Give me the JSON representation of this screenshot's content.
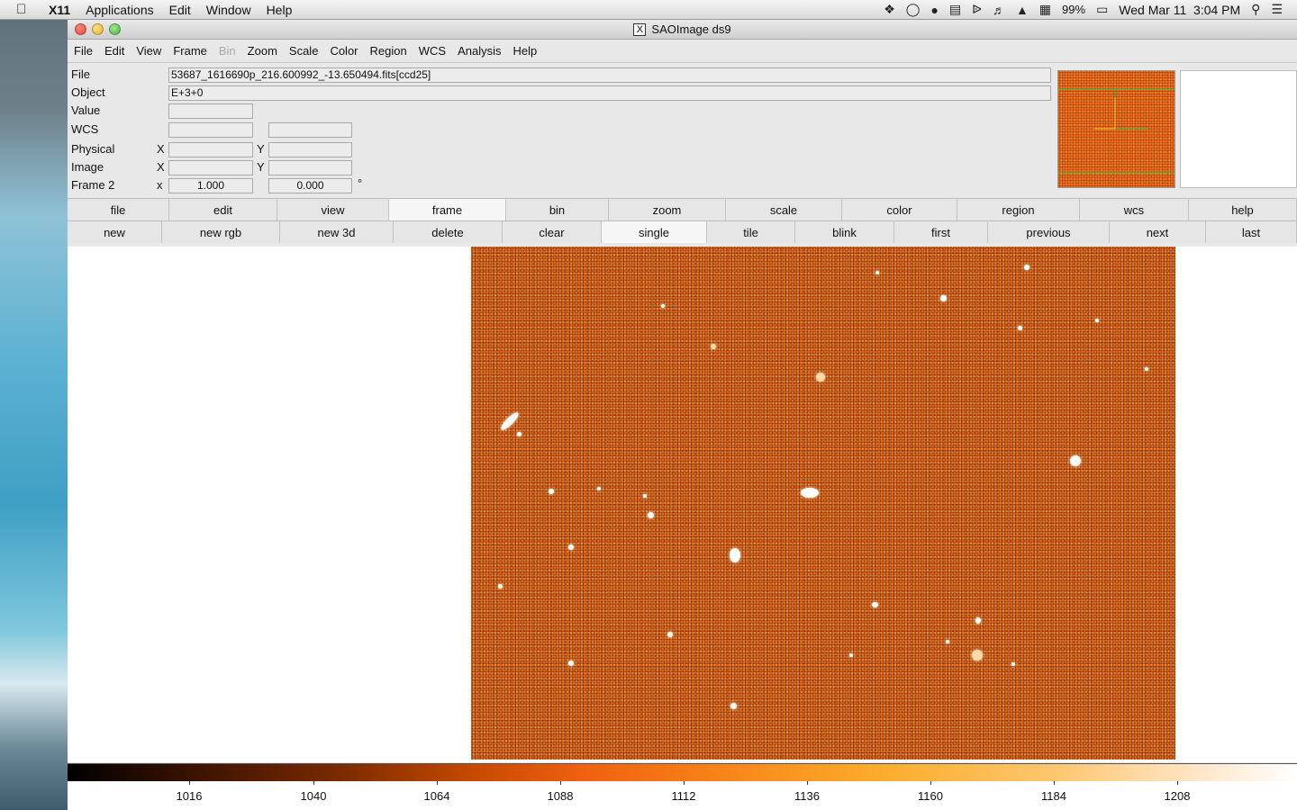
{
  "menubar": {
    "app_name": "X11",
    "items": [
      "Applications",
      "Edit",
      "Window",
      "Help"
    ],
    "battery": "99%",
    "clock": "Wed Mar 11  3:04 PM"
  },
  "window": {
    "title": "SAOImage ds9",
    "menu": [
      "File",
      "Edit",
      "View",
      "Frame",
      "Bin",
      "Zoom",
      "Scale",
      "Color",
      "Region",
      "WCS",
      "Analysis",
      "Help"
    ]
  },
  "info": {
    "file_label": "File",
    "file_value": "53687_1616690p_216.600992_-13.650494.fits[ccd25]",
    "object_label": "Object",
    "object_value": "E+3+0",
    "value_label": "Value",
    "wcs_label": "WCS",
    "physical_label": "Physical",
    "image_label": "Image",
    "frame_label": "Frame 2",
    "x_label": "X",
    "y_label": "Y",
    "x_lower": "x",
    "frame_zoom": "1.000",
    "frame_angle": "0.000",
    "degree_symbol": "°"
  },
  "buttonbar_main": [
    "file",
    "edit",
    "view",
    "frame",
    "bin",
    "zoom",
    "scale",
    "color",
    "region",
    "wcs",
    "help"
  ],
  "buttonbar_frame": [
    "new",
    "new rgb",
    "new 3d",
    "delete",
    "clear",
    "single",
    "tile",
    "blink",
    "first",
    "previous",
    "next",
    "last"
  ],
  "colorbar": {
    "ticks": [
      "1016",
      "1040",
      "1064",
      "1088",
      "1112",
      "1136",
      "1160",
      "1184",
      "1208"
    ],
    "colormap_colors": [
      "#000000",
      "#c64a00",
      "#f06010",
      "#fcac2a",
      "#ffffff"
    ]
  },
  "accent": "#ef6d1c"
}
